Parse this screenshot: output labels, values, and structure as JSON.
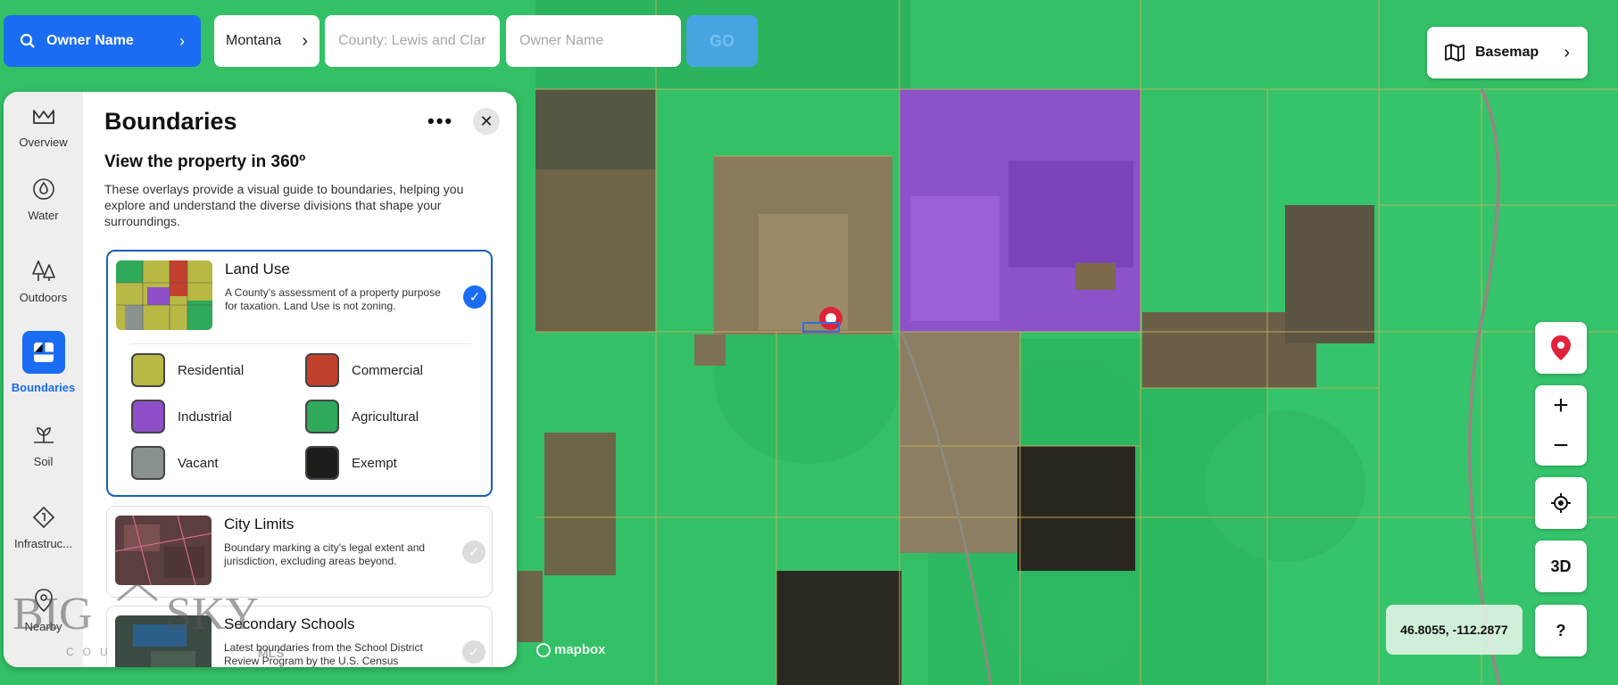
{
  "search": {
    "mode_label": "Owner Name",
    "state_label": "Montana",
    "county_placeholder": "County: Lewis and Clark",
    "owner_placeholder": "Owner Name",
    "go_label": "GO"
  },
  "basemap": {
    "label": "Basemap"
  },
  "map": {
    "attribution": "mapbox",
    "coordinates": "46.8055, -112.2877",
    "three_d_label": "3D",
    "help_label": "?",
    "zoom_in": "+",
    "zoom_out": "−"
  },
  "sidebar": {
    "items": [
      {
        "label": "Overview",
        "icon": "chart-line-icon"
      },
      {
        "label": "Water",
        "icon": "water-drop-icon"
      },
      {
        "label": "Outdoors",
        "icon": "trees-icon"
      },
      {
        "label": "Boundaries",
        "icon": "boundaries-icon",
        "active": true
      },
      {
        "label": "Soil",
        "icon": "plant-icon"
      },
      {
        "label": "Infrastruc...",
        "icon": "infrastructure-icon"
      },
      {
        "label": "Nearby",
        "icon": "location-pin-icon"
      }
    ]
  },
  "panel": {
    "title": "Boundaries",
    "subtitle": "View the property in 360º",
    "description": "These overlays provide a visual guide to boundaries, helping you explore and understand the diverse divisions that shape your surroundings.",
    "cards": [
      {
        "title": "Land Use",
        "description": "A County's assessment of a property purpose for taxation. Land Use is not zoning.",
        "selected": true
      },
      {
        "title": "City Limits",
        "description": "Boundary marking a city's legal extent and jurisdiction, excluding areas beyond.",
        "selected": false
      },
      {
        "title": "Secondary Schools",
        "description": "Latest boundaries from the School District Review Program by the U.S. Census",
        "selected": false
      }
    ],
    "legend": [
      {
        "label": "Residential",
        "color": "#b8b845"
      },
      {
        "label": "Commercial",
        "color": "#c2412c"
      },
      {
        "label": "Industrial",
        "color": "#8e4fc9"
      },
      {
        "label": "Agricultural",
        "color": "#2fa95a"
      },
      {
        "label": "Vacant",
        "color": "#8a9290"
      },
      {
        "label": "Exempt",
        "color": "#1d1d1b"
      }
    ]
  },
  "watermark": {
    "line1": "BIG",
    "line2": "SKY",
    "small": "COU",
    "badge": "MLS"
  },
  "colors": {
    "accent": "#1a6cf2",
    "map_green": "#2fbf63",
    "parcel_line": "#c9b35a"
  }
}
